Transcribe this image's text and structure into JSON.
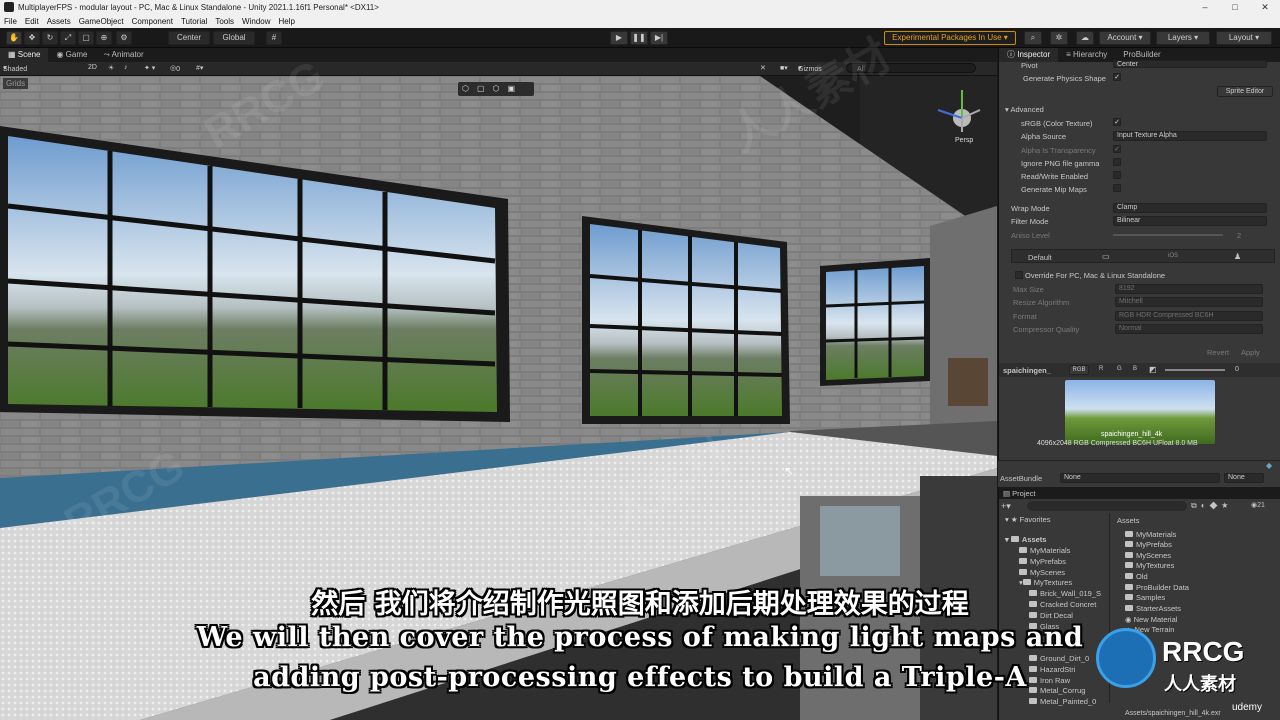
{
  "window": {
    "title": "MultiplayerFPS - modular layout - PC, Mac & Linux Standalone - Unity 2021.1.16f1 Personal* <DX11>"
  },
  "menu": [
    "File",
    "Edit",
    "Assets",
    "GameObject",
    "Component",
    "Tutorial",
    "Tools",
    "Window",
    "Help"
  ],
  "toolbar": {
    "center": "Center",
    "global": "Global",
    "experimental": "Experimental Packages In Use",
    "account": "Account",
    "layers": "Layers",
    "layout": "Layout"
  },
  "scene_tabs": [
    "Scene",
    "Game",
    "Animator"
  ],
  "scene_toolbar": {
    "shading": "Shaded",
    "mode_2d": "2D",
    "gizmos": "Gizmos",
    "search_placeholder": "All",
    "grids_label": "Grids",
    "persp_label": "Persp",
    "hidden_count": "0"
  },
  "inspector": {
    "tabs": [
      "Inspector",
      "Hierarchy",
      "ProBuilder"
    ],
    "pivot_label": "Pivot",
    "pivot_value": "Center",
    "physics_shape": "Generate Physics Shape",
    "sprite_editor": "Sprite Editor",
    "advanced": "Advanced",
    "rows": [
      {
        "label": "sRGB (Color Texture)",
        "value": "✓",
        "type": "check",
        "dim": false
      },
      {
        "label": "Alpha Source",
        "value": "Input Texture Alpha",
        "type": "select",
        "dim": false
      },
      {
        "label": "Alpha Is Transparency",
        "value": "✓",
        "type": "check",
        "dim": true
      },
      {
        "label": "Ignore PNG file gamma",
        "value": "",
        "type": "check",
        "dim": false
      },
      {
        "label": "Read/Write Enabled",
        "value": "",
        "type": "check",
        "dim": false
      },
      {
        "label": "Generate Mip Maps",
        "value": "",
        "type": "check",
        "dim": false
      }
    ],
    "wrap_mode": "Wrap Mode",
    "wrap_value": "Clamp",
    "filter_mode": "Filter Mode",
    "filter_value": "Bilinear",
    "aniso": "Aniso Level",
    "aniso_value": "2",
    "platform_tabs": [
      "Default",
      "iOS"
    ],
    "override": "Override For PC, Mac & Linux Standalone",
    "platform_rows": [
      {
        "label": "Max Size",
        "value": "8192"
      },
      {
        "label": "Resize Algorithm",
        "value": "Mitchell"
      },
      {
        "label": "Format",
        "value": "RGB HDR Compressed BC6H"
      },
      {
        "label": "Compressor Quality",
        "value": "Normal"
      }
    ],
    "revert": "Revert",
    "apply": "Apply",
    "preview_name": "spaichingen_",
    "channels": [
      "RGB",
      "R",
      "G",
      "B"
    ],
    "mip_value": "0",
    "preview_label": "spaichingen_hill_4k",
    "preview_info": "4096x2048  RGB Compressed BC6H UFloat  8.0 MB"
  },
  "asset_bundle": {
    "label": "AssetBundle",
    "value": "None",
    "variant": "None"
  },
  "project": {
    "tab": "Project",
    "favorites": "Favorites",
    "assets_root": "Assets",
    "count": "21",
    "tree": [
      "MyMaterials",
      "MyPrefabs",
      "MyScenes",
      "MyTextures",
      "Brick_Wall_019_S",
      "Cracked Concret",
      "Dirt Decal",
      "Glass",
      "Ground_Dirt_0",
      "HazardStri",
      "Iron Raw",
      "Metal_Corrug",
      "Metal_Painted_0"
    ],
    "assets_header": "Assets",
    "assets": [
      "MyMaterials",
      "MyPrefabs",
      "MyScenes",
      "MyTextures",
      "Old",
      "ProBuilder Data",
      "Samples",
      "StarterAssets",
      "New Material",
      "New Terrain"
    ],
    "path": "Assets/spaichingen_hill_4k.exr"
  },
  "subtitles": {
    "cn": "然后 我们将介绍制作光照图和添加后期处理效果的过程",
    "en1": "We will then cover the process of making light maps and",
    "en2": "adding post-processing effects to build a Triple-A"
  },
  "watermark": {
    "brand": "RRCG",
    "cn": "人人素材",
    "site": "udemy"
  }
}
